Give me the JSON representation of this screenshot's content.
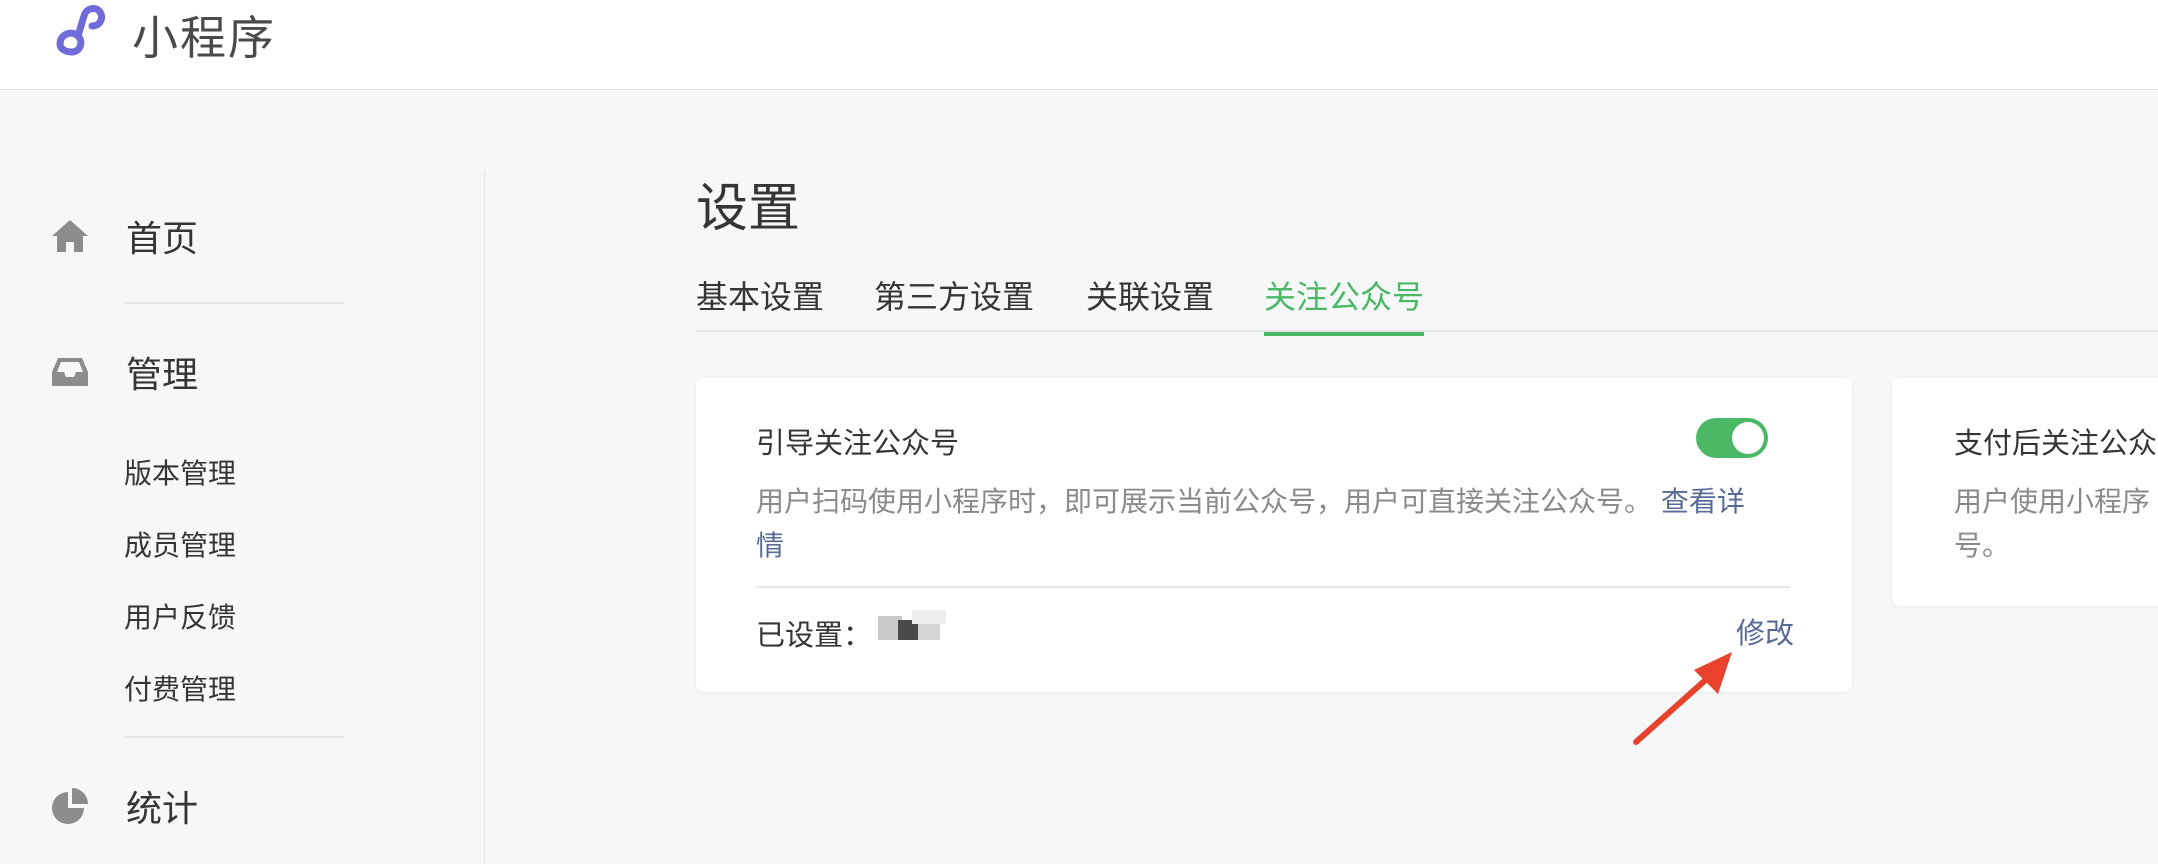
{
  "header": {
    "app_title": "小程序",
    "logo_icon": "mini-program-logo-icon"
  },
  "sidebar": {
    "home": {
      "label": "首页",
      "icon": "home-icon"
    },
    "manage": {
      "label": "管理",
      "icon": "inbox-icon",
      "items": [
        "版本管理",
        "成员管理",
        "用户反馈",
        "付费管理"
      ]
    },
    "stats": {
      "label": "统计",
      "icon": "pie-chart-icon"
    }
  },
  "main": {
    "title": "设置",
    "tabs": [
      {
        "label": "基本设置"
      },
      {
        "label": "第三方设置"
      },
      {
        "label": "关联设置"
      },
      {
        "label": "关注公众号",
        "active": true
      }
    ],
    "cards": [
      {
        "title": "引导关注公众号",
        "desc": "用户扫码使用小程序时，即可展示当前公众号，用户可直接关注公众号。 ",
        "link": "查看详情",
        "toggle_on": true,
        "set_label": "已设置：",
        "edit_label": "修改"
      },
      {
        "title": "支付后关注公众",
        "desc": "用户使用小程序",
        "desc2": "号。"
      }
    ]
  },
  "colors": {
    "accent_green": "#4bb865",
    "link": "#576b95",
    "arrow": "#e8412c"
  }
}
